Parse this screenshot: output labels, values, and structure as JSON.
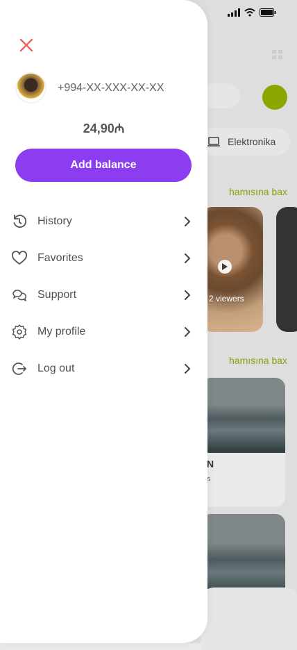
{
  "drawer": {
    "phone": "+994-XX-XXX-XX-XX",
    "balance": "24,90₼",
    "add_balance_label": "Add balance",
    "menu": [
      {
        "label": "History",
        "icon": "history-icon"
      },
      {
        "label": "Favorites",
        "icon": "heart-icon"
      },
      {
        "label": "Support",
        "icon": "chat-icon"
      },
      {
        "label": "My profile",
        "icon": "gear-icon"
      },
      {
        "label": "Log out",
        "icon": "logout-icon"
      }
    ]
  },
  "background": {
    "category_chip": "Elektronika",
    "see_all_1": "hamısına bax",
    "see_all_2": "hamısına bax",
    "viewers_text": "2 viewers",
    "car_title_fragment": "N",
    "car_sub_fragment": "s"
  },
  "colors": {
    "accent": "#8c3df0",
    "brand_green": "#88a300",
    "close_red": "#f0625c"
  }
}
